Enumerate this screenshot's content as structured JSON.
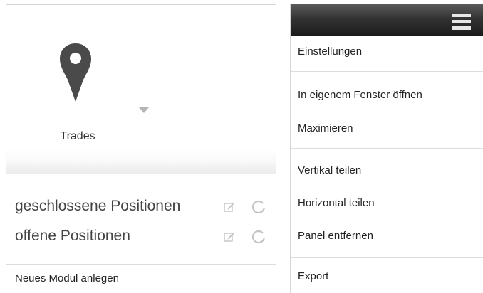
{
  "module": {
    "title": "Trades",
    "icon": "map-pin-icon",
    "items": [
      {
        "label": "geschlossene Positionen"
      },
      {
        "label": "offene Positionen"
      }
    ],
    "new_module_label": "Neues Modul anlegen"
  },
  "menu": {
    "icon": "hamburger-icon",
    "items": [
      {
        "label": "Einstellungen"
      },
      {
        "label": "In eigenem Fenster öffnen"
      },
      {
        "label": "Maximieren"
      },
      {
        "label": "Vertikal teilen"
      },
      {
        "label": "Horizontal teilen"
      },
      {
        "label": "Panel entfernen"
      },
      {
        "label": "Export"
      }
    ]
  },
  "colors": {
    "pin": "#4a4a4a",
    "topbar_dark": "#1c1c1c",
    "icon_muted": "#c4c4c4"
  }
}
